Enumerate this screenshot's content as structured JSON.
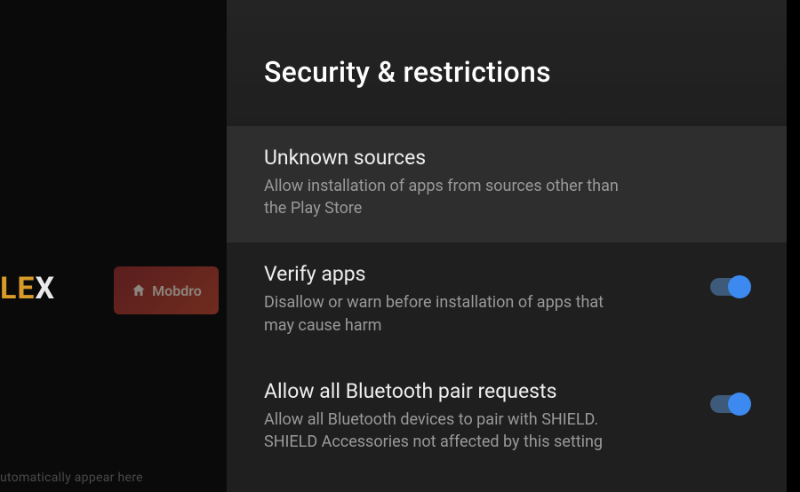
{
  "background": {
    "app1_prefix": "LE",
    "app1_suffix": "X",
    "app2_label": "Mobdro",
    "bottom_text": "utomatically appear here"
  },
  "panel": {
    "title": "Security & restrictions",
    "settings": [
      {
        "title": "Unknown sources",
        "description": "Allow installation of apps from sources other than the Play Store",
        "highlighted": true,
        "has_toggle": false
      },
      {
        "title": "Verify apps",
        "description": "Disallow or warn before installation of apps that may cause harm",
        "highlighted": false,
        "has_toggle": true,
        "toggle_on": true
      },
      {
        "title": "Allow all Bluetooth pair requests",
        "description": "Allow all Bluetooth devices to pair with SHIELD. SHIELD Accessories not affected by this setting",
        "highlighted": false,
        "has_toggle": true,
        "toggle_on": true
      }
    ]
  }
}
